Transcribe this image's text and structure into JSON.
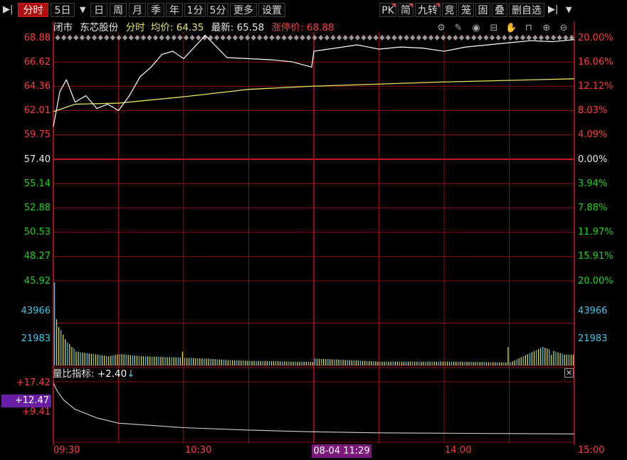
{
  "toolbar": {
    "items": [
      "分时",
      "5日",
      "日",
      "周",
      "月",
      "季",
      "年",
      "1分",
      "5分",
      "更多",
      "设置"
    ],
    "right_items": [
      "PK",
      "简",
      "九转",
      "竞",
      "笼",
      "固",
      "叠",
      "删自选"
    ],
    "dropdown_glyph": "▼",
    "pin_glyph": "▶|"
  },
  "info": {
    "status": "闭市",
    "stock_name": "东芯股份",
    "mode": "分时",
    "avg_label": "均价:",
    "avg_value": "64.35",
    "last_label": "最新:",
    "last_value": "65.58",
    "limit_label": "涨停价:",
    "limit_value": "68.88"
  },
  "icons": [
    "settings-icon",
    "brush-icon",
    "eye-icon",
    "basket-icon",
    "hand-icon",
    "lock-icon",
    "zoom-in-icon",
    "zoom-out-icon"
  ],
  "colors": {
    "price_line": "#ffffff",
    "avg_line": "#e6e65a",
    "grid": "#8a1010",
    "up": "#ff3b3b",
    "down": "#19d219",
    "volume_up": "#d8d84a",
    "volume_down": "#3ec8ea"
  },
  "chart_data": {
    "type": "line",
    "title": "东芯股份 分时",
    "prev_close": 57.4,
    "price_axis": [
      "68.88",
      "66.62",
      "64.36",
      "62.01",
      "59.75",
      "57.40",
      "55.14",
      "52.88",
      "50.53",
      "48.27",
      "45.92"
    ],
    "pct_axis": [
      "20.00%",
      "16.06%",
      "12.12%",
      "8.03%",
      "4.09%",
      "0.00%",
      "3.94%",
      "7.88%",
      "11.97%",
      "15.91%",
      "20.00%"
    ],
    "ylim": [
      45.92,
      68.88
    ],
    "time_labels": [
      "09:30",
      "10:30",
      "14:00",
      "15:00"
    ],
    "cursor_time": "08-04 11:29",
    "series": [
      {
        "name": "最新",
        "x": [
          "09:30",
          "09:33",
          "09:36",
          "09:40",
          "09:45",
          "09:50",
          "09:55",
          "10:00",
          "10:05",
          "10:10",
          "10:15",
          "10:20",
          "10:25",
          "10:30",
          "10:40",
          "10:50",
          "11:00",
          "11:10",
          "11:20",
          "11:29",
          "13:00",
          "13:10",
          "13:20",
          "13:30",
          "13:40",
          "13:50",
          "14:00",
          "14:10",
          "14:20",
          "14:30",
          "14:40",
          "14:50",
          "15:00"
        ],
        "values": [
          60.5,
          63.8,
          64.9,
          62.8,
          63.4,
          62.2,
          62.6,
          62.0,
          63.4,
          65.2,
          66.1,
          67.3,
          67.6,
          66.9,
          69.1,
          67.0,
          66.9,
          66.8,
          66.6,
          66.1,
          67.6,
          67.9,
          68.2,
          67.8,
          68.0,
          67.9,
          67.6,
          68.0,
          68.2,
          68.4,
          68.6,
          68.5,
          68.7
        ]
      },
      {
        "name": "均价",
        "x": [
          "09:30",
          "09:40",
          "10:00",
          "10:30",
          "11:00",
          "11:29",
          "13:30",
          "14:00",
          "15:00"
        ],
        "values": [
          61.9,
          62.6,
          62.7,
          63.3,
          64.0,
          64.3,
          64.5,
          64.7,
          65.0
        ]
      }
    ],
    "volume": {
      "axis": [
        "43966",
        "21983"
      ],
      "max": 55000,
      "x": [
        "09:30",
        "09:31",
        "09:32",
        "09:33",
        "09:34",
        "09:35",
        "09:36",
        "09:37",
        "09:38",
        "09:39",
        "09:40",
        "09:45",
        "09:50",
        "09:55",
        "10:00",
        "10:10",
        "10:20",
        "10:30",
        "10:40",
        "10:50",
        "11:00",
        "11:10",
        "11:20",
        "11:29",
        "13:00",
        "13:30",
        "14:00",
        "14:30",
        "14:45",
        "14:55"
      ],
      "values": [
        54000,
        30000,
        25000,
        23000,
        20000,
        17000,
        15000,
        14000,
        12000,
        11000,
        9000,
        8000,
        7000,
        6000,
        7500,
        6000,
        5500,
        5000,
        4500,
        3500,
        3000,
        2800,
        2500,
        2300,
        4500,
        2500,
        2500,
        2000,
        12000,
        7000
      ]
    },
    "indicator": {
      "name": "量比指标:",
      "value": "+2.40",
      "arrow": "↓",
      "axis": [
        "+17.42",
        "+12.47",
        "+9.41"
      ],
      "ylim": [
        0,
        17.42
      ],
      "x": [
        "09:30",
        "09:32",
        "09:35",
        "09:40",
        "09:50",
        "10:00",
        "10:30",
        "11:00",
        "11:29",
        "13:30",
        "14:00",
        "14:30",
        "15:00"
      ],
      "values": [
        17.0,
        14.5,
        12.0,
        9.5,
        7.0,
        5.5,
        4.2,
        3.5,
        3.0,
        2.7,
        2.6,
        2.5,
        2.4
      ]
    }
  }
}
